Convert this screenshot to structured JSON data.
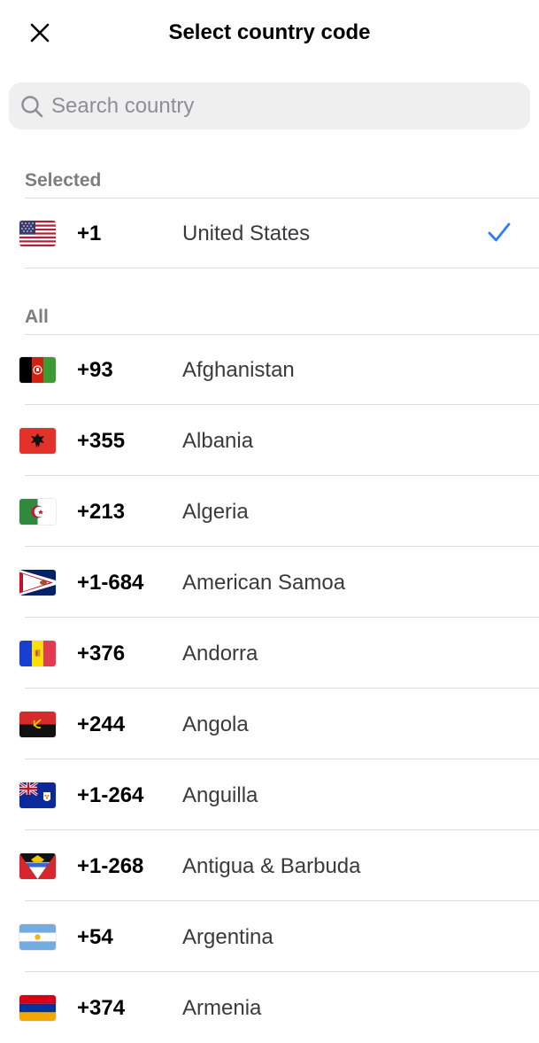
{
  "header": {
    "title": "Select country code",
    "close_icon": "close-icon"
  },
  "search": {
    "placeholder": "Search country",
    "value": "",
    "icon": "search-icon"
  },
  "sections": {
    "selected_label": "Selected",
    "all_label": "All"
  },
  "selected": {
    "code": "+1",
    "name": "United States",
    "flag": "us-flag-icon",
    "check_icon": "checkmark-icon",
    "accent_color": "#2f7ef6"
  },
  "countries": [
    {
      "code": "+93",
      "name": "Afghanistan",
      "flag": "af-flag-icon"
    },
    {
      "code": "+355",
      "name": "Albania",
      "flag": "al-flag-icon"
    },
    {
      "code": "+213",
      "name": "Algeria",
      "flag": "dz-flag-icon"
    },
    {
      "code": "+1-684",
      "name": "American Samoa",
      "flag": "as-flag-icon"
    },
    {
      "code": "+376",
      "name": "Andorra",
      "flag": "ad-flag-icon"
    },
    {
      "code": "+244",
      "name": "Angola",
      "flag": "ao-flag-icon"
    },
    {
      "code": "+1-264",
      "name": "Anguilla",
      "flag": "ai-flag-icon"
    },
    {
      "code": "+1-268",
      "name": "Antigua & Barbuda",
      "flag": "ag-flag-icon"
    },
    {
      "code": "+54",
      "name": "Argentina",
      "flag": "ar-flag-icon"
    },
    {
      "code": "+374",
      "name": "Armenia",
      "flag": "am-flag-icon"
    }
  ]
}
